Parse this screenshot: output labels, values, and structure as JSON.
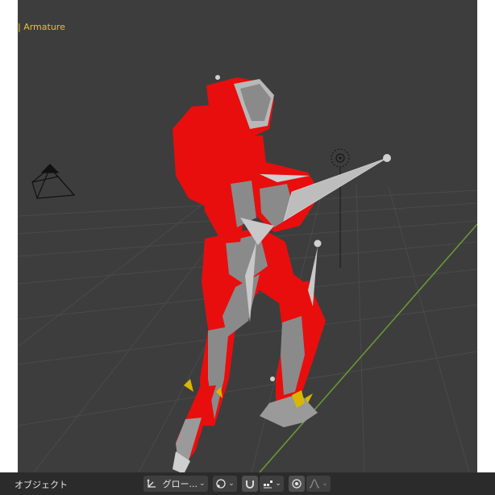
{
  "viewport": {
    "active_object": "| Armature"
  },
  "header": {
    "mode_label": "オブジェクト",
    "orientation_label": "グロー...",
    "orientation_icon": "transform-orientation-icon",
    "pivot_icon": "pivot-point-icon",
    "snap_icon": "snap-magnet-icon",
    "snap_target_icon": "snap-increment-icon",
    "proportional_icon": "proportional-edit-icon",
    "falloff_icon": "falloff-curve-icon",
    "chevron": "⌄"
  },
  "colors": {
    "viewport_bg": "#3d3d3d",
    "grid_line": "#4a4a4a",
    "y_axis": "#6b9b37",
    "model_red": "#e80e0e",
    "model_gray": "#8a8a8a",
    "text_accent": "#e8c232"
  }
}
